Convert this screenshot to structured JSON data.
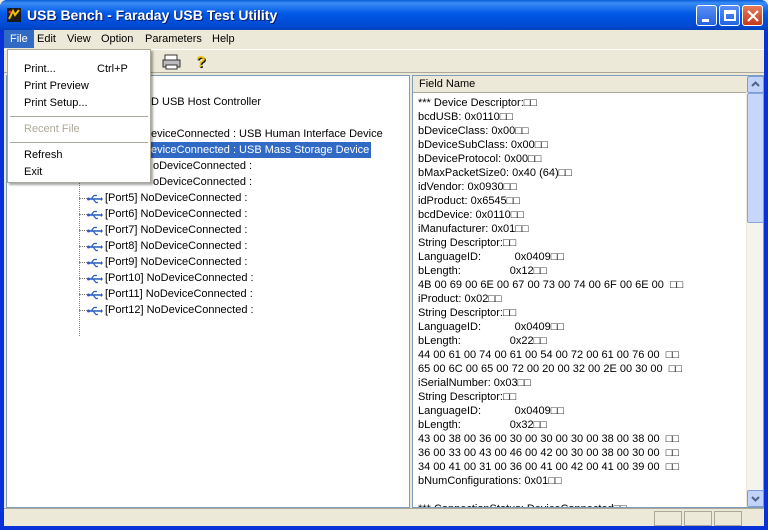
{
  "window": {
    "title": "USB Bench - Faraday USB Test Utility"
  },
  "menubar": {
    "items": [
      "File",
      "Edit",
      "View",
      "Option",
      "Parameters",
      "Help"
    ]
  },
  "file_menu": {
    "print": "Print...",
    "print_shortcut": "Ctrl+P",
    "print_preview": "Print Preview",
    "print_setup": "Print Setup...",
    "recent_file": "Recent File",
    "refresh": "Refresh",
    "exit": "Exit"
  },
  "tree": {
    "host_controller_partial": "D USB Host Controller",
    "port1_partial": "eviceConnected : USB Human Interface Device",
    "port2_partial": "eviceConnected : USB Mass Storage Device",
    "port3_partial": "oDeviceConnected :",
    "port4_partial": "oDeviceConnected :",
    "ports": [
      "[Port5] NoDeviceConnected :",
      "[Port6] NoDeviceConnected :",
      "[Port7] NoDeviceConnected :",
      "[Port8] NoDeviceConnected :",
      "[Port9] NoDeviceConnected :",
      "[Port10] NoDeviceConnected :",
      "[Port11] NoDeviceConnected :",
      "[Port12] NoDeviceConnected :"
    ]
  },
  "details": {
    "column_header": "Field Name",
    "rows": [
      "*** Device Descriptor:□□",
      "bcdUSB: 0x0110□□",
      "bDeviceClass: 0x00□□",
      "bDeviceSubClass: 0x00□□",
      "bDeviceProtocol: 0x00□□",
      "bMaxPacketSize0: 0x40 (64)□□",
      "idVendor: 0x0930□□",
      "idProduct: 0x6545□□",
      "bcdDevice: 0x0110□□",
      "iManufacturer: 0x01□□",
      "String Descriptor:□□",
      "LanguageID:           0x0409□□",
      "bLength:                0x12□□",
      "4B 00 69 00 6E 00 67 00 73 00 74 00 6F 00 6E 00  □□",
      "iProduct: 0x02□□",
      "String Descriptor:□□",
      "LanguageID:           0x0409□□",
      "bLength:                0x22□□",
      "44 00 61 00 74 00 61 00 54 00 72 00 61 00 76 00  □□",
      "65 00 6C 00 65 00 72 00 20 00 32 00 2E 00 30 00  □□",
      "iSerialNumber: 0x03□□",
      "String Descriptor:□□",
      "LanguageID:           0x0409□□",
      "bLength:                0x32□□",
      "43 00 38 00 36 00 30 00 30 00 30 00 38 00 38 00  □□",
      "36 00 33 00 43 00 46 00 42 00 30 00 38 00 30 00  □□",
      "34 00 41 00 31 00 36 00 41 00 42 00 41 00 39 00  □□",
      "bNumConfigurations: 0x01□□",
      "",
      "*** ConnectionStatus: DeviceConnected□□"
    ]
  },
  "colors": {
    "titlebar": "#0058e6",
    "selection": "#316ac5",
    "usb_icon": "#2b59c3"
  }
}
